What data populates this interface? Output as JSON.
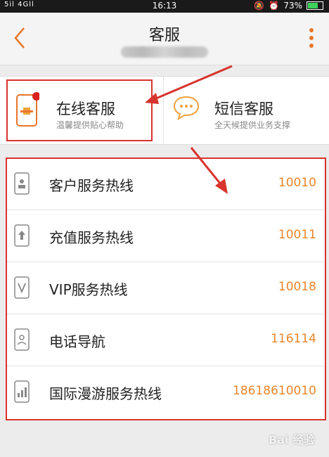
{
  "status_bar": {
    "signal_text": "5il 4Gll",
    "time": "16:13",
    "battery": "73%"
  },
  "header": {
    "title": "客服"
  },
  "services": [
    {
      "title": "在线客服",
      "subtitle": "温馨提供贴心帮助"
    },
    {
      "title": "短信客服",
      "subtitle": "全天候提供业务支撑"
    }
  ],
  "hotlines": [
    {
      "label": "客户服务热线",
      "number": "10010",
      "icon": "person-phone-icon"
    },
    {
      "label": "充值服务热线",
      "number": "10011",
      "icon": "upload-phone-icon"
    },
    {
      "label": "VIP服务热线",
      "number": "10018",
      "icon": "vip-phone-icon"
    },
    {
      "label": "电话导航",
      "number": "116114",
      "icon": "navigation-phone-icon"
    },
    {
      "label": "国际漫游服务热线",
      "number": "18618610010",
      "icon": "roaming-phone-icon"
    }
  ],
  "watermark": "Bai 经验",
  "colors": {
    "accent": "#e8762a",
    "highlight": "#d8342e",
    "number": "#e8862a"
  }
}
